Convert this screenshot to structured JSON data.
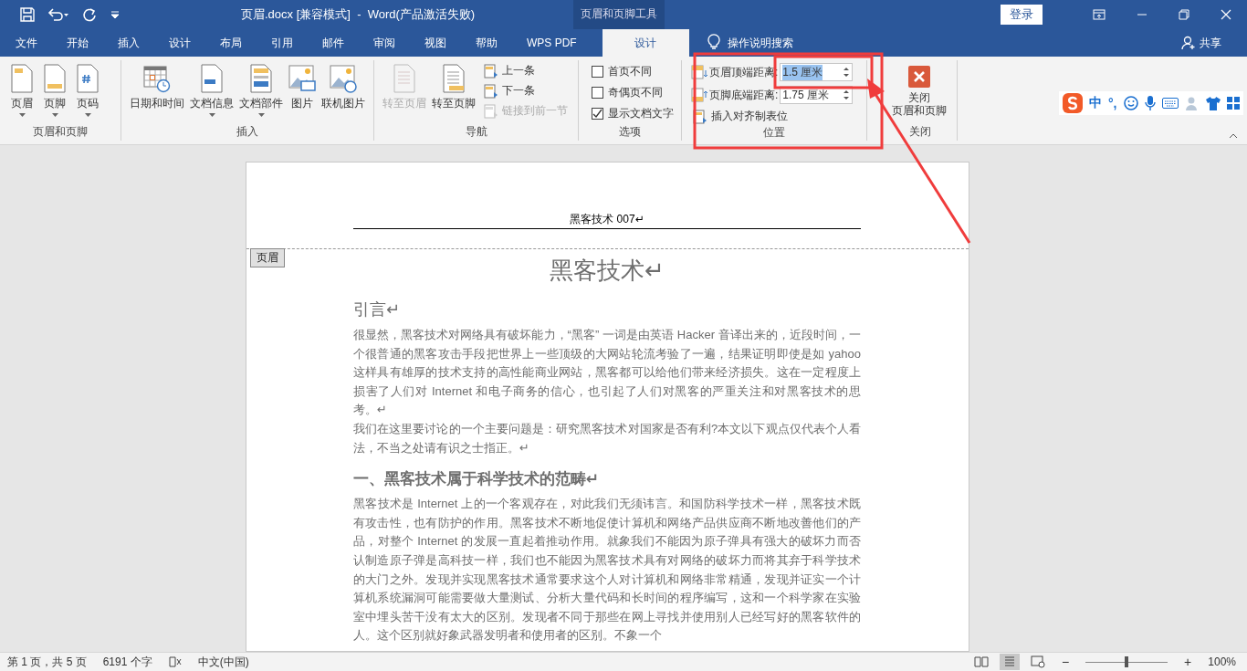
{
  "title_bar": {
    "title": "页眉.docx [兼容模式]  -  Word(产品激活失败)",
    "contextual_tab": "页眉和页脚工具",
    "login": "登录"
  },
  "tabs": [
    {
      "label": "文件",
      "selected": false
    },
    {
      "label": "开始",
      "selected": false
    },
    {
      "label": "插入",
      "selected": false
    },
    {
      "label": "设计",
      "selected": false
    },
    {
      "label": "布局",
      "selected": false
    },
    {
      "label": "引用",
      "selected": false
    },
    {
      "label": "邮件",
      "selected": false
    },
    {
      "label": "审阅",
      "selected": false
    },
    {
      "label": "视图",
      "selected": false
    },
    {
      "label": "帮助",
      "selected": false
    },
    {
      "label": "WPS PDF",
      "selected": false
    },
    {
      "label": "设计",
      "selected": true
    }
  ],
  "tell_me": "操作说明搜索",
  "share": "共享",
  "ribbon": [
    {
      "label": "页眉和页脚",
      "items": [
        {
          "kind": "large",
          "label": "页眉",
          "dropdown": true,
          "disabled": false
        },
        {
          "kind": "large",
          "label": "页脚",
          "dropdown": true,
          "disabled": false
        },
        {
          "kind": "large",
          "label": "页码",
          "dropdown": true,
          "disabled": false
        }
      ]
    },
    {
      "label": "插入",
      "items": [
        {
          "kind": "large",
          "label": "日期和时间",
          "dropdown": false,
          "disabled": false
        },
        {
          "kind": "large",
          "label": "文档信息",
          "dropdown": true,
          "disabled": false
        },
        {
          "kind": "large",
          "label": "文档部件",
          "dropdown": true,
          "disabled": false
        },
        {
          "kind": "large",
          "label": "图片",
          "dropdown": false,
          "disabled": false
        },
        {
          "kind": "large",
          "label": "联机图片",
          "dropdown": false,
          "disabled": false
        }
      ]
    },
    {
      "label": "导航",
      "items": [
        {
          "kind": "large",
          "label": "转至页眉",
          "dropdown": false,
          "disabled": true
        },
        {
          "kind": "large",
          "label": "转至页脚",
          "dropdown": false,
          "disabled": false
        },
        {
          "kind": "small",
          "label": "上一条",
          "disabled": false
        },
        {
          "kind": "small",
          "label": "下一条",
          "disabled": false
        },
        {
          "kind": "small",
          "label": "链接到前一节",
          "disabled": true
        }
      ]
    },
    {
      "label": "选项",
      "items": [
        {
          "kind": "check",
          "label": "首页不同",
          "checked": false
        },
        {
          "kind": "check",
          "label": "奇偶页不同",
          "checked": false
        },
        {
          "kind": "check",
          "label": "显示文档文字",
          "checked": true
        }
      ]
    },
    {
      "label": "位置",
      "items": [
        {
          "kind": "spin",
          "label": "页眉顶端距离:",
          "value": "1.5 厘米",
          "value_selected": true
        },
        {
          "kind": "spin",
          "label": "页脚底端距离:",
          "value": "1.75 厘米",
          "value_selected": false
        },
        {
          "kind": "small",
          "label": "插入对齐制表位",
          "disabled": false
        }
      ]
    },
    {
      "label": "关闭",
      "items": [
        {
          "kind": "close",
          "lines": [
            "关闭",
            "页眉和页脚"
          ]
        }
      ]
    }
  ],
  "ime": {
    "mode": "中",
    "punct": "°,"
  },
  "document": {
    "header_text": "黑客技术 007↵",
    "header_tag": "页眉",
    "title": "黑客技术↵",
    "blocks": [
      {
        "kind": "heading",
        "text": "引言↵"
      },
      {
        "kind": "para",
        "text": "很显然，黑客技术对网络具有破坏能力，“黑客” 一词是由英语 Hacker 音译出来的，近段时间，一个很普通的黑客攻击手段把世界上一些顶级的大网站轮流考验了一遍，结果证明即使是如 yahoo 这样具有雄厚的技术支持的高性能商业网站，黑客都可以给他们带来经济损失。这在一定程度上损害了人们对 Internet 和电子商务的信心，也引起了人们对黑客的严重关注和对黑客技术的思考。↵"
      },
      {
        "kind": "para",
        "text": "我们在这里要讨论的一个主要问题是：研究黑客技术对国家是否有利?本文以下观点仅代表个人看法，不当之处请有识之士指正。↵"
      },
      {
        "kind": "heading2",
        "text": "一、黑客技术属于科学技术的范畴↵"
      },
      {
        "kind": "para",
        "text": "黑客技术是 Internet 上的一个客观存在，对此我们无须讳言。和国防科学技术一样，黑客技术既有攻击性，也有防护的作用。黑客技术不断地促使计算机和网络产品供应商不断地改善他们的产品，对整个 Internet 的发展一直起着推动作用。就象我们不能因为原子弹具有强大的破坏力而否认制造原子弹是高科技一样，我们也不能因为黑客技术具有对网络的破坏力而将其弃于科学技术的大门之外。发现并实现黑客技术通常要求这个人对计算机和网络非常精通，发现并证实一个计算机系统漏洞可能需要做大量测试、分析大量代码和长时间的程序编写，这和一个科学家在实验室中埋头苦干没有太大的区别。发现者不同于那些在网上寻找并使用别人已经写好的黑客软件的人。这个区别就好象武器发明者和使用者的区别。不象一个"
      }
    ]
  },
  "status_bar": {
    "page": "第 1 页，共 5 页",
    "words": "6191 个字",
    "language": "中文(中国)",
    "zoom": "100%",
    "zoom_out": "−",
    "zoom_in": "+",
    "zoom_slider": {
      "level": 0.5
    }
  }
}
